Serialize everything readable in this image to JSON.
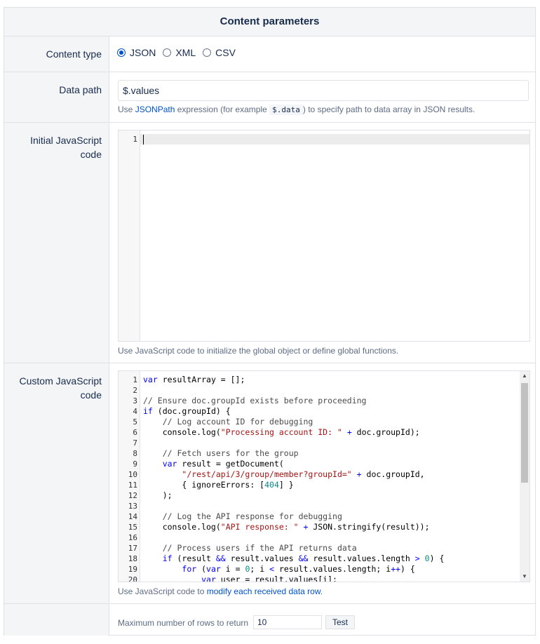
{
  "header": {
    "title": "Content parameters"
  },
  "content_type": {
    "label": "Content type",
    "options": [
      {
        "label": "JSON",
        "checked": true
      },
      {
        "label": "XML",
        "checked": false
      },
      {
        "label": "CSV",
        "checked": false
      }
    ]
  },
  "data_path": {
    "label": "Data path",
    "value": "$.values",
    "help_prefix": "Use",
    "help_link": "JSONPath",
    "help_middle": "expression (for example",
    "help_code": "$.data",
    "help_suffix": ") to specify path to data array in JSON results."
  },
  "initial_js": {
    "label_line1": "Initial JavaScript",
    "label_line2": "code",
    "line_numbers": [
      "1"
    ],
    "help": "Use JavaScript code to initialize the global object or define global functions."
  },
  "custom_js": {
    "label_line1": "Custom JavaScript",
    "label_line2": "code",
    "line_numbers": [
      "1",
      "2",
      "3",
      "4",
      "5",
      "6",
      "7",
      "8",
      "9",
      "10",
      "11",
      "12",
      "13",
      "14",
      "15",
      "16",
      "17",
      "18",
      "19",
      "20"
    ],
    "help_prefix": "Use JavaScript code to",
    "help_link": "modify each received data row",
    "help_suffix": "."
  },
  "footer": {
    "max_rows_label": "Maximum number of rows to return",
    "max_rows_value": "10",
    "test_button": "Test"
  },
  "icons": {
    "scroll_up": "triangle-up-icon",
    "scroll_down": "triangle-down-icon"
  }
}
